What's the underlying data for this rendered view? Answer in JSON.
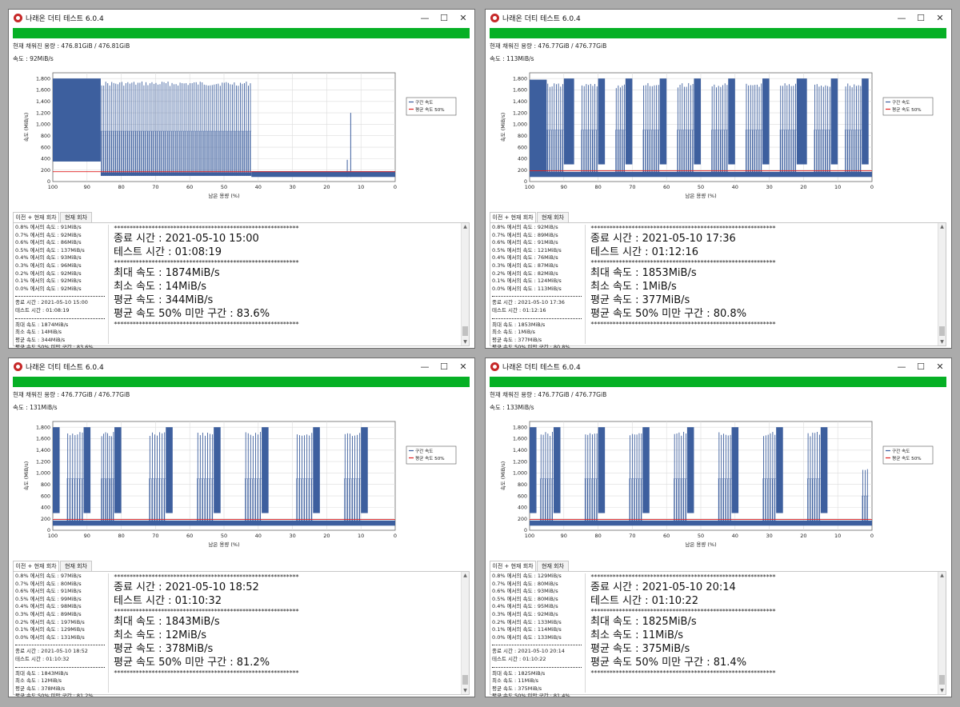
{
  "windows": [
    {
      "title": "나래온 더티 테스트 6.0.4",
      "capacity_text": "현재 채워진 용량 : 476.81GiB / 476.81GiB",
      "speed_text": "속도 : 92MiB/s",
      "progress": 1.0,
      "tabs": [
        "이전 + 현재 회차",
        "현재 회차"
      ],
      "small_speeds": [
        "0.8% 에서의 속도 : 91MiB/s",
        "0.7% 에서의 속도 : 92MiB/s",
        "0.6% 에서의 속도 : 86MiB/s",
        "0.5% 에서의 속도 : 137MiB/s",
        "0.4% 에서의 속도 : 93MiB/s",
        "0.3% 에서의 속도 : 96MiB/s",
        "0.2% 에서의 속도 : 92MiB/s",
        "0.1% 에서의 속도 : 92MiB/s",
        "0.0% 에서의 속도 : 92MiB/s"
      ],
      "small_times": [
        "종료 시간 : 2021-05-10 15:00",
        "테스트 시간 : 01:08:19"
      ],
      "small_stats": [
        "최대 속도 : 1874MiB/s",
        "최소 속도 : 14MiB/s",
        "평균 속도 : 344MiB/s",
        "평균 속도 50% 미만 구간 : 83.6%"
      ],
      "big_times": [
        "종료 시간 : 2021-05-10 15:00",
        "테스트 시간 : 01:08:19"
      ],
      "big_stats": [
        "최대 속도 : 1874MiB/s",
        "최소 속도 : 14MiB/s",
        "평균 속도 : 344MiB/s",
        "평균 속도 50% 미만 구간 : 83.6%"
      ],
      "stars": "***********************************************************",
      "chart_data": {
        "type": "line",
        "title": "",
        "xlabel": "남은 용량 (%)",
        "ylabel": "속도 (MiB/s)",
        "xlim": [
          100,
          0
        ],
        "ylim": [
          0,
          1900
        ],
        "x_ticks": [
          "100",
          "90",
          "80",
          "70",
          "60",
          "50",
          "40",
          "30",
          "20",
          "10",
          "0"
        ],
        "y_ticks": [
          "0",
          "200",
          "400",
          "600",
          "800",
          "1,000",
          "1,200",
          "1,400",
          "1,600",
          "1,800"
        ],
        "legend": {
          "placement": "right",
          "entries": [
            "구간 속도",
            "평균 속도 50%"
          ]
        },
        "grid": true,
        "avg_half_line": 172,
        "series_color": "#3d5f9e",
        "avg_color": "#e02020",
        "segments": [
          {
            "x_from": 100,
            "x_to": 86,
            "low": 350,
            "high": 1800,
            "mode": "solid"
          },
          {
            "x_from": 86,
            "x_to": 42,
            "low": 100,
            "high": 1750,
            "mode": "spikes",
            "spike_count": 75,
            "mid": 880
          }
        ],
        "tail": {
          "x_from": 42,
          "x_to": 0,
          "low": 80,
          "high": 180
        },
        "isolated_spikes": [
          {
            "x": 13,
            "value": 1200
          },
          {
            "x": 14,
            "value": 380
          }
        ]
      }
    },
    {
      "title": "나래온 더티 테스트 6.0.4",
      "capacity_text": "현재 채워진 용량 : 476.77GiB / 476.77GiB",
      "speed_text": "속도 : 113MiB/s",
      "progress": 1.0,
      "tabs": [
        "이전 + 현재 회차",
        "현재 회차"
      ],
      "small_speeds": [
        "0.8% 에서의 속도 : 92MiB/s",
        "0.7% 에서의 속도 : 89MiB/s",
        "0.6% 에서의 속도 : 91MiB/s",
        "0.5% 에서의 속도 : 121MiB/s",
        "0.4% 에서의 속도 : 76MiB/s",
        "0.3% 에서의 속도 : 87MiB/s",
        "0.2% 에서의 속도 : 82MiB/s",
        "0.1% 에서의 속도 : 124MiB/s",
        "0.0% 에서의 속도 : 113MiB/s"
      ],
      "small_times": [
        "종료 시간 : 2021-05-10 17:36",
        "테스트 시간 : 01:12:16"
      ],
      "small_stats": [
        "최대 속도 : 1853MiB/s",
        "최소 속도 : 1MiB/s",
        "평균 속도 : 377MiB/s",
        "평균 속도 50% 미만 구간 : 80.8%"
      ],
      "big_times": [
        "종료 시간 : 2021-05-10 17:36",
        "테스트 시간 : 01:12:16"
      ],
      "big_stats": [
        "최대 속도 : 1853MiB/s",
        "최소 속도 : 1MiB/s",
        "평균 속도 : 377MiB/s",
        "평균 속도 50% 미만 구간 : 80.8%"
      ],
      "stars": "***********************************************************",
      "chart_data": {
        "type": "line",
        "title": "",
        "xlabel": "남은 용량 (%)",
        "ylabel": "속도 (MiB/s)",
        "xlim": [
          100,
          0
        ],
        "ylim": [
          0,
          1900
        ],
        "x_ticks": [
          "100",
          "90",
          "80",
          "70",
          "60",
          "50",
          "40",
          "30",
          "20",
          "10",
          "0"
        ],
        "y_ticks": [
          "0",
          "200",
          "400",
          "600",
          "800",
          "1,000",
          "1,200",
          "1,400",
          "1,600",
          "1,800"
        ],
        "legend": {
          "placement": "right",
          "entries": [
            "구간 속도",
            "평균 속도 50%"
          ]
        },
        "grid": true,
        "avg_half_line": 190,
        "series_color": "#3d5f9e",
        "avg_color": "#e02020",
        "segments": [
          {
            "x_from": 100,
            "x_to": 95,
            "low": 120,
            "high": 1780,
            "mode": "solid"
          },
          {
            "x_from": 95,
            "x_to": 90,
            "low": 110,
            "high": 1720,
            "mode": "spikes",
            "spike_count": 8,
            "mid": 900
          },
          {
            "x_from": 90,
            "x_to": 87,
            "low": 300,
            "high": 1800,
            "mode": "solid"
          },
          {
            "x_from": 85,
            "x_to": 80,
            "low": 110,
            "high": 1720,
            "mode": "spikes",
            "spike_count": 8,
            "mid": 900
          },
          {
            "x_from": 80,
            "x_to": 78,
            "low": 300,
            "high": 1800,
            "mode": "solid"
          },
          {
            "x_from": 75,
            "x_to": 72,
            "low": 110,
            "high": 1700,
            "mode": "spikes",
            "spike_count": 5,
            "mid": 900
          },
          {
            "x_from": 72,
            "x_to": 70,
            "low": 300,
            "high": 1800,
            "mode": "solid"
          },
          {
            "x_from": 67,
            "x_to": 62,
            "low": 110,
            "high": 1720,
            "mode": "spikes",
            "spike_count": 8,
            "mid": 900
          },
          {
            "x_from": 62,
            "x_to": 60,
            "low": 300,
            "high": 1800,
            "mode": "solid"
          },
          {
            "x_from": 57,
            "x_to": 52,
            "low": 110,
            "high": 1720,
            "mode": "spikes",
            "spike_count": 8,
            "mid": 900
          },
          {
            "x_from": 52,
            "x_to": 50,
            "low": 300,
            "high": 1800,
            "mode": "solid"
          },
          {
            "x_from": 47,
            "x_to": 42,
            "low": 110,
            "high": 1720,
            "mode": "spikes",
            "spike_count": 8,
            "mid": 900
          },
          {
            "x_from": 42,
            "x_to": 40,
            "low": 300,
            "high": 1800,
            "mode": "solid"
          },
          {
            "x_from": 37,
            "x_to": 32,
            "low": 110,
            "high": 1720,
            "mode": "spikes",
            "spike_count": 8,
            "mid": 900
          },
          {
            "x_from": 32,
            "x_to": 30,
            "low": 300,
            "high": 1800,
            "mode": "solid"
          },
          {
            "x_from": 27,
            "x_to": 22,
            "low": 110,
            "high": 1720,
            "mode": "spikes",
            "spike_count": 8,
            "mid": 900
          },
          {
            "x_from": 22,
            "x_to": 19,
            "low": 300,
            "high": 1800,
            "mode": "solid"
          },
          {
            "x_from": 17,
            "x_to": 12,
            "low": 110,
            "high": 1720,
            "mode": "spikes",
            "spike_count": 8,
            "mid": 900
          },
          {
            "x_from": 12,
            "x_to": 10,
            "low": 300,
            "high": 1800,
            "mode": "solid"
          },
          {
            "x_from": 8,
            "x_to": 3,
            "low": 110,
            "high": 1720,
            "mode": "spikes",
            "spike_count": 8,
            "mid": 900
          },
          {
            "x_from": 3,
            "x_to": 1,
            "low": 300,
            "high": 1800,
            "mode": "solid"
          }
        ],
        "tail": {
          "x_from": 100,
          "x_to": 0,
          "low": 80,
          "high": 170
        },
        "isolated_spikes": []
      }
    },
    {
      "title": "나래온 더티 테스트 6.0.4",
      "capacity_text": "현재 채워진 용량 : 476.77GiB / 476.77GiB",
      "speed_text": "속도 : 131MiB/s",
      "progress": 1.0,
      "tabs": [
        "이전 + 현재 회차",
        "현재 회차"
      ],
      "small_speeds": [
        "0.8% 에서의 속도 : 97MiB/s",
        "0.7% 에서의 속도 : 80MiB/s",
        "0.6% 에서의 속도 : 91MiB/s",
        "0.5% 에서의 속도 : 99MiB/s",
        "0.4% 에서의 속도 : 98MiB/s",
        "0.3% 에서의 속도 : 89MiB/s",
        "0.2% 에서의 속도 : 197MiB/s",
        "0.1% 에서의 속도 : 129MiB/s",
        "0.0% 에서의 속도 : 131MiB/s"
      ],
      "small_times": [
        "종료 시간 : 2021-05-10 18:52",
        "테스트 시간 : 01:10:32"
      ],
      "small_stats": [
        "최대 속도 : 1843MiB/s",
        "최소 속도 : 12MiB/s",
        "평균 속도 : 378MiB/s",
        "평균 속도 50% 미만 구간 : 81.2%"
      ],
      "big_times": [
        "종료 시간 : 2021-05-10 18:52",
        "테스트 시간 : 01:10:32"
      ],
      "big_stats": [
        "최대 속도 : 1843MiB/s",
        "최소 속도 : 12MiB/s",
        "평균 속도 : 378MiB/s",
        "평균 속도 50% 미만 구간 : 81.2%"
      ],
      "stars": "***********************************************************",
      "chart_data": {
        "type": "line",
        "title": "",
        "xlabel": "남은 용량 (%)",
        "ylabel": "속도 (MiB/s)",
        "xlim": [
          100,
          0
        ],
        "ylim": [
          0,
          1900
        ],
        "x_ticks": [
          "100",
          "90",
          "80",
          "70",
          "60",
          "50",
          "40",
          "30",
          "20",
          "10",
          "0"
        ],
        "y_ticks": [
          "0",
          "200",
          "400",
          "600",
          "800",
          "1,000",
          "1,200",
          "1,400",
          "1,600",
          "1,800"
        ],
        "legend": {
          "placement": "right",
          "entries": [
            "구간 속도",
            "평균 속도 50%"
          ]
        },
        "grid": true,
        "avg_half_line": 190,
        "series_color": "#3d5f9e",
        "avg_color": "#e02020",
        "segments": [
          {
            "x_from": 100,
            "x_to": 98,
            "low": 300,
            "high": 1800,
            "mode": "solid"
          },
          {
            "x_from": 96,
            "x_to": 91,
            "low": 110,
            "high": 1720,
            "mode": "spikes",
            "spike_count": 7,
            "mid": 900
          },
          {
            "x_from": 91,
            "x_to": 89,
            "low": 300,
            "high": 1800,
            "mode": "solid"
          },
          {
            "x_from": 86,
            "x_to": 82,
            "low": 110,
            "high": 1720,
            "mode": "spikes",
            "spike_count": 7,
            "mid": 900
          },
          {
            "x_from": 82,
            "x_to": 80,
            "low": 300,
            "high": 1800,
            "mode": "solid"
          },
          {
            "x_from": 72,
            "x_to": 67,
            "low": 110,
            "high": 1720,
            "mode": "spikes",
            "spike_count": 7,
            "mid": 900
          },
          {
            "x_from": 67,
            "x_to": 65,
            "low": 300,
            "high": 1800,
            "mode": "solid"
          },
          {
            "x_from": 58,
            "x_to": 53,
            "low": 110,
            "high": 1720,
            "mode": "spikes",
            "spike_count": 7,
            "mid": 900
          },
          {
            "x_from": 53,
            "x_to": 51,
            "low": 300,
            "high": 1800,
            "mode": "solid"
          },
          {
            "x_from": 44,
            "x_to": 39,
            "low": 110,
            "high": 1720,
            "mode": "spikes",
            "spike_count": 7,
            "mid": 900
          },
          {
            "x_from": 39,
            "x_to": 37,
            "low": 300,
            "high": 1800,
            "mode": "solid"
          },
          {
            "x_from": 29,
            "x_to": 24,
            "low": 110,
            "high": 1720,
            "mode": "spikes",
            "spike_count": 7,
            "mid": 900
          },
          {
            "x_from": 24,
            "x_to": 22,
            "low": 300,
            "high": 1800,
            "mode": "solid"
          },
          {
            "x_from": 15,
            "x_to": 10,
            "low": 110,
            "high": 1720,
            "mode": "spikes",
            "spike_count": 7,
            "mid": 900
          },
          {
            "x_from": 10,
            "x_to": 8,
            "low": 300,
            "high": 1800,
            "mode": "solid"
          }
        ],
        "tail": {
          "x_from": 100,
          "x_to": 0,
          "low": 80,
          "high": 170
        },
        "isolated_spikes": []
      }
    },
    {
      "title": "나래온 더티 테스트 6.0.4",
      "capacity_text": "현재 채워진 용량 : 476.77GiB / 476.77GiB",
      "speed_text": "속도 : 133MiB/s",
      "progress": 1.0,
      "tabs": [
        "이전 + 현재 회차",
        "현재 회차"
      ],
      "small_speeds": [
        "0.8% 에서의 속도 : 129MiB/s",
        "0.7% 에서의 속도 : 80MiB/s",
        "0.6% 에서의 속도 : 93MiB/s",
        "0.5% 에서의 속도 : 80MiB/s",
        "0.4% 에서의 속도 : 95MiB/s",
        "0.3% 에서의 속도 : 92MiB/s",
        "0.2% 에서의 속도 : 133MiB/s",
        "0.1% 에서의 속도 : 114MiB/s",
        "0.0% 에서의 속도 : 133MiB/s"
      ],
      "small_times": [
        "종료 시간 : 2021-05-10 20:14",
        "테스트 시간 : 01:10:22"
      ],
      "small_stats": [
        "최대 속도 : 1825MiB/s",
        "최소 속도 : 11MiB/s",
        "평균 속도 : 375MiB/s",
        "평균 속도 50% 미만 구간 : 81.4%"
      ],
      "big_times": [
        "종료 시간 : 2021-05-10 20:14",
        "테스트 시간 : 01:10:22"
      ],
      "big_stats": [
        "최대 속도 : 1825MiB/s",
        "최소 속도 : 11MiB/s",
        "평균 속도 : 375MiB/s",
        "평균 속도 50% 미만 구간 : 81.4%"
      ],
      "stars": "***********************************************************",
      "chart_data": {
        "type": "line",
        "title": "",
        "xlabel": "남은 용량 (%)",
        "ylabel": "속도 (MiB/s)",
        "xlim": [
          100,
          0
        ],
        "ylim": [
          0,
          1900
        ],
        "x_ticks": [
          "100",
          "90",
          "80",
          "70",
          "60",
          "50",
          "40",
          "30",
          "20",
          "10",
          "0"
        ],
        "y_ticks": [
          "0",
          "200",
          "400",
          "600",
          "800",
          "1,000",
          "1,200",
          "1,400",
          "1,600",
          "1,800"
        ],
        "legend": {
          "placement": "right",
          "entries": [
            "구간 속도",
            "평균 속도 50%"
          ]
        },
        "grid": true,
        "avg_half_line": 190,
        "series_color": "#3d5f9e",
        "avg_color": "#e02020",
        "segments": [
          {
            "x_from": 100,
            "x_to": 98,
            "low": 300,
            "high": 1800,
            "mode": "solid"
          },
          {
            "x_from": 97,
            "x_to": 93,
            "low": 110,
            "high": 1720,
            "mode": "spikes",
            "spike_count": 6,
            "mid": 900
          },
          {
            "x_from": 93,
            "x_to": 91,
            "low": 300,
            "high": 1800,
            "mode": "solid"
          },
          {
            "x_from": 84,
            "x_to": 80,
            "low": 110,
            "high": 1720,
            "mode": "spikes",
            "spike_count": 6,
            "mid": 900
          },
          {
            "x_from": 80,
            "x_to": 78,
            "low": 300,
            "high": 1800,
            "mode": "solid"
          },
          {
            "x_from": 71,
            "x_to": 67,
            "low": 110,
            "high": 1720,
            "mode": "spikes",
            "spike_count": 6,
            "mid": 900
          },
          {
            "x_from": 67,
            "x_to": 65,
            "low": 300,
            "high": 1800,
            "mode": "solid"
          },
          {
            "x_from": 58,
            "x_to": 54,
            "low": 110,
            "high": 1720,
            "mode": "spikes",
            "spike_count": 6,
            "mid": 900
          },
          {
            "x_from": 54,
            "x_to": 52,
            "low": 300,
            "high": 1800,
            "mode": "solid"
          },
          {
            "x_from": 45,
            "x_to": 41,
            "low": 110,
            "high": 1720,
            "mode": "spikes",
            "spike_count": 6,
            "mid": 900
          },
          {
            "x_from": 41,
            "x_to": 39,
            "low": 300,
            "high": 1800,
            "mode": "solid"
          },
          {
            "x_from": 32,
            "x_to": 28,
            "low": 110,
            "high": 1720,
            "mode": "spikes",
            "spike_count": 6,
            "mid": 900
          },
          {
            "x_from": 28,
            "x_to": 26,
            "low": 300,
            "high": 1800,
            "mode": "solid"
          },
          {
            "x_from": 19,
            "x_to": 15,
            "low": 110,
            "high": 1720,
            "mode": "spikes",
            "spike_count": 6,
            "mid": 900
          },
          {
            "x_from": 15,
            "x_to": 13,
            "low": 300,
            "high": 1800,
            "mode": "solid"
          },
          {
            "x_from": 3,
            "x_to": 1,
            "low": 110,
            "high": 1100,
            "mode": "spikes",
            "spike_count": 3,
            "mid": 600
          }
        ],
        "tail": {
          "x_from": 100,
          "x_to": 0,
          "low": 80,
          "high": 170
        },
        "isolated_spikes": []
      }
    }
  ]
}
